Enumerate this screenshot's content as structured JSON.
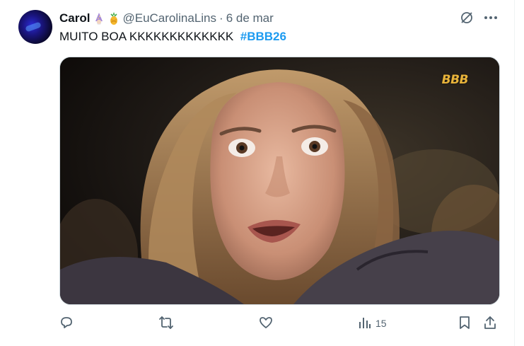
{
  "tweet": {
    "author_name": "Carol",
    "author_emojis": [
      "wizard-emoji",
      "pineapple-emoji"
    ],
    "handle": "@EuCarolinaLins",
    "separator": "·",
    "date": "6 de mar",
    "text": "MUITO BOA KKKKKKKKKKKKK",
    "hashtag": "#BBB26"
  },
  "media": {
    "watermark": "BBB",
    "description_icon": "photo"
  },
  "actions": {
    "reply_icon": "reply-icon",
    "retweet_icon": "retweet-icon",
    "like_icon": "heart-icon",
    "views_icon": "views-icon",
    "views_count": "15",
    "bookmark_icon": "bookmark-icon",
    "share_icon": "share-icon"
  },
  "colors": {
    "link": "#1d9bf0",
    "muted": "#536471",
    "text": "#0f1419",
    "watermark": "#e8b33a"
  }
}
